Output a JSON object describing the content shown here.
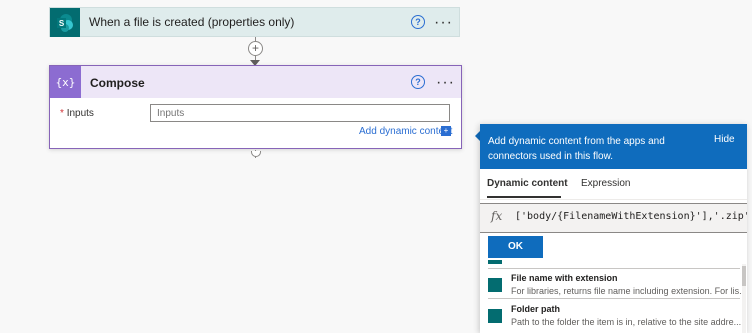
{
  "trigger": {
    "title": "When a file is created (properties only)",
    "icon": "sharepoint-icon",
    "help": "?",
    "more": "···"
  },
  "connector": {
    "add": "+"
  },
  "compose": {
    "title": "Compose",
    "icon": "compose-icon",
    "icon_glyph": "{x}",
    "help": "?",
    "more": "···",
    "required_mark": "*",
    "inputs_label": "Inputs",
    "inputs_placeholder": "Inputs",
    "add_dynamic_label": "Add dynamic content",
    "add_dynamic_icon": "+"
  },
  "dynamic_panel": {
    "description": "Add dynamic content from the apps and connectors used in this flow.",
    "hide_label": "Hide",
    "tabs": [
      {
        "label": "Dynamic content",
        "active": true
      },
      {
        "label": "Expression",
        "active": false
      }
    ],
    "fx_symbol": "fx",
    "expression": "['body/{FilenameWithExtension}'],'.zip')",
    "ok_label": "OK",
    "items": [
      {
        "title": "File name with extension",
        "description": "For libraries, returns file name including extension. For lis..."
      },
      {
        "title": "Folder path",
        "description": "Path to the folder the item is in, relative to the site addre..."
      }
    ]
  },
  "colors": {
    "accent": "#0f6cbd",
    "sharepoint": "#036c70",
    "compose": "#8c6cd1",
    "trigger_bg": "#dfecec",
    "compose_header_bg": "#ede6f7"
  }
}
